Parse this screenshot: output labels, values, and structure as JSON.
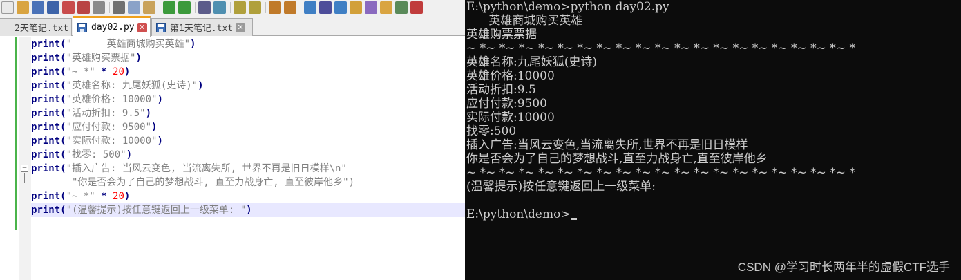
{
  "tabs": [
    {
      "label": "2天笔记.txt",
      "active": false,
      "icon": "text-file-icon"
    },
    {
      "label": "day02.py",
      "active": true,
      "icon": "save-disk-icon"
    },
    {
      "label": "第1天笔记.txt",
      "active": false,
      "icon": "save-disk-icon"
    }
  ],
  "code": {
    "keyword": "print",
    "lines": [
      {
        "str": "\"      英雄商城购买英雄\""
      },
      {
        "str": "\"英雄购买票据\""
      },
      {
        "str": "\"~ *\"",
        "op": " * ",
        "num": "20"
      },
      {
        "str": "\"英雄名称: 九尾妖狐(史诗)\""
      },
      {
        "str": "\"英雄价格: 10000\""
      },
      {
        "str": "\"活动折扣: 9.5\""
      },
      {
        "str": "\"应付付款: 9500\""
      },
      {
        "str": "\"实际付款: 10000\""
      },
      {
        "str": "\"找零: 500\""
      },
      {
        "str": "\"插入广告: 当风云变色, 当流离失所, 世界不再是旧日模样\\n\"",
        "no_close": true
      },
      {
        "continuation": "       \"你是否会为了自己的梦想战斗, 直至力战身亡, 直至彼岸他乡\")"
      },
      {
        "str": "\"~ *\"",
        "op": " * ",
        "num": "20"
      },
      {
        "str": "\"(温馨提示)按任意键返回上一级菜单: \"",
        "current": true
      }
    ]
  },
  "console": {
    "lines": [
      "E:\\python\\demo>python day02.py",
      "      英雄商城购买英雄",
      "英雄购票票据",
      "~ *~ *~ *~ *~ *~ *~ *~ *~ *~ *~ *~ *~ *~ *~ *~ *~ *~ *~ *~ *",
      "英雄名称:九尾妖狐(史诗)",
      "英雄价格:10000",
      "活动折扣:9.5",
      "应付付款:9500",
      "实际付款:10000",
      "找零:500",
      "插入广告:当风云变色,当流离失所,世界不再是旧日模样",
      "你是否会为了自己的梦想战斗,直至力战身亡,直至彼岸他乡",
      "~ *~ *~ *~ *~ *~ *~ *~ *~ *~ *~ *~ *~ *~ *~ *~ *~ *~ *~ *~ *",
      "(温馨提示)按任意键返回上一级菜单:",
      "",
      "E:\\python\\demo>"
    ]
  },
  "watermark": "CSDN @学习时长两年半的虚假CTF选手",
  "colors": {
    "keyword": "#000080",
    "string": "#808080",
    "number": "#ff0000",
    "console_bg": "#0c0c0c",
    "console_text": "#cccccc",
    "active_tab_accent": "#f0a11c",
    "change_bar": "#4bb44b"
  }
}
